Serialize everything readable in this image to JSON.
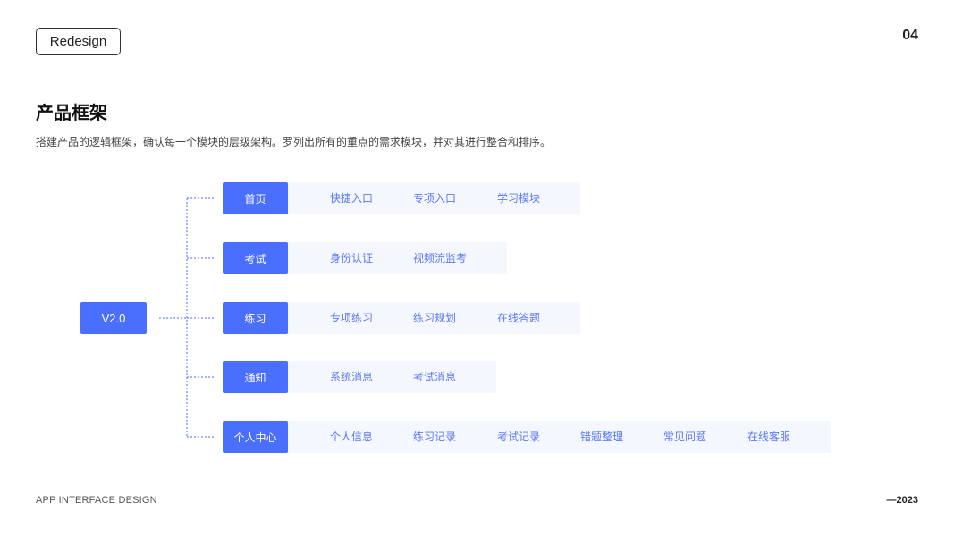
{
  "header": {
    "tag": "Redesign",
    "page_number": "04"
  },
  "section": {
    "title": "产品框架",
    "description": "搭建产品的逻辑框架，确认每一个模块的层级架构。罗列出所有的重点的需求模块，并对其进行整合和排序。"
  },
  "diagram": {
    "root": "V2.0",
    "modules": [
      {
        "label": "首页",
        "items": [
          "快捷入口",
          "专项入口",
          "学习模块"
        ]
      },
      {
        "label": "考试",
        "items": [
          "身份认证",
          "视频流监考"
        ]
      },
      {
        "label": "练习",
        "items": [
          "专项练习",
          "练习规划",
          "在线答题"
        ]
      },
      {
        "label": "通知",
        "items": [
          "系统消息",
          "考试消息"
        ]
      },
      {
        "label": "个人中心",
        "items": [
          "个人信息",
          "练习记录",
          "考试记录",
          "错题整理",
          "常见问题",
          "在线客服"
        ]
      }
    ]
  },
  "footer": {
    "left": "APP INTERFACE DESIGN",
    "right": "—2023"
  },
  "colors": {
    "accent": "#4a6ffd",
    "item_text": "#5a79f0",
    "item_bg": "#f5f7fe",
    "connector": "#4a6ffd"
  }
}
